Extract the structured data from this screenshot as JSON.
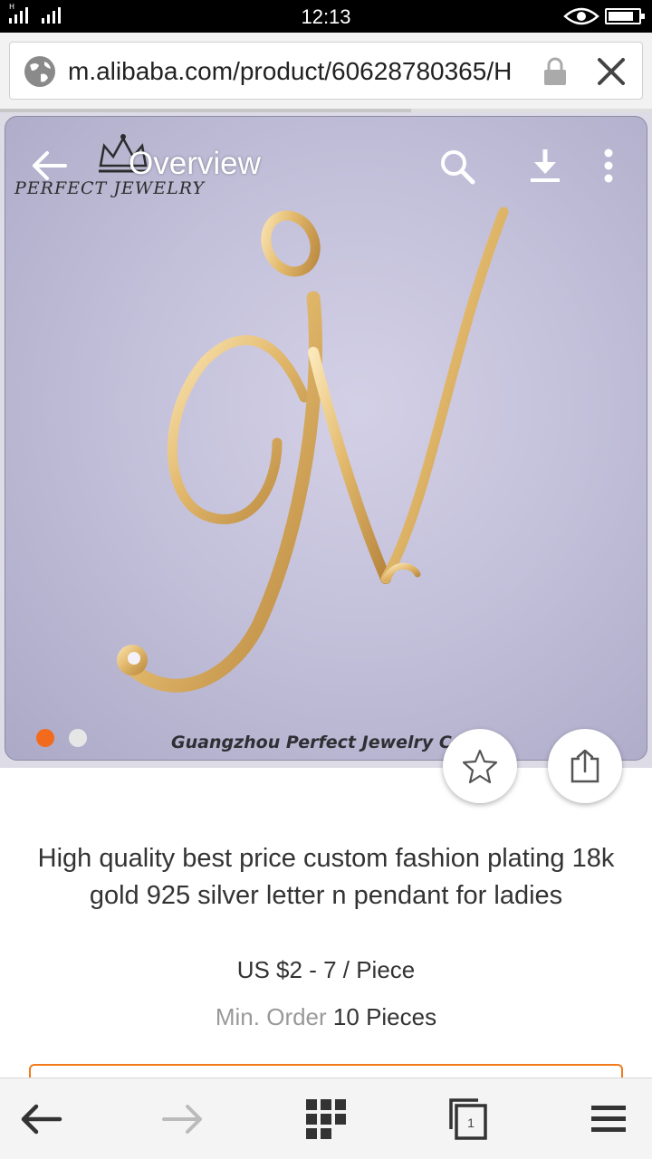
{
  "status_bar": {
    "time": "12:13",
    "signal_label": "H",
    "battery_level": 0.85
  },
  "browser": {
    "url": "m.alibaba.com/product/60628780365/H",
    "load_progress": 0.63,
    "icons": [
      "globe-icon",
      "lock-icon",
      "close-icon"
    ]
  },
  "gallery": {
    "title": "Overview",
    "brand_text": "PERFECT JEWELRY",
    "watermark": "Guangzhou Perfect Jewelry Co.",
    "slide_count": 2,
    "active_slide": 1,
    "icons": [
      "back-arrow-icon",
      "search-icon",
      "download-icon",
      "more-vertical-icon",
      "star-icon",
      "share-icon"
    ]
  },
  "product": {
    "title": "High quality best price custom fashion plating 18k gold 925 silver letter n pendant for ladies",
    "price": "US $2 - 7 / Piece",
    "min_order_label": "Min. Order",
    "min_order_value": "10 Pieces"
  },
  "bottom_nav": {
    "tab_count": "1",
    "icons": [
      "back-arrow-icon",
      "forward-arrow-icon",
      "apps-grid-icon",
      "tabs-icon",
      "menu-icon"
    ]
  },
  "colors": {
    "accent": "#f27a1a",
    "active_dot": "#f26b1d",
    "inactive_dot": "#e6e6e6",
    "gold": "#e2b96c"
  }
}
